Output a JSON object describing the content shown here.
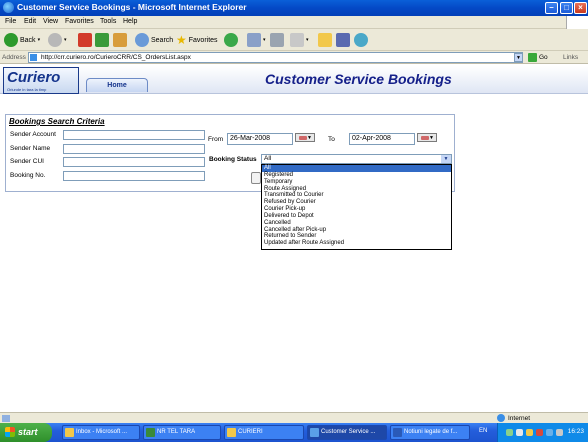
{
  "window": {
    "title": "Customer Service Bookings - Microsoft Internet Explorer"
  },
  "menu": [
    "File",
    "Edit",
    "View",
    "Favorites",
    "Tools",
    "Help"
  ],
  "toolbar": {
    "back": "Back",
    "search": "Search",
    "favorites": "Favorites"
  },
  "address": {
    "label": "Address",
    "url": "http://crr.curiero.ro/CurieroCRR/CS_OrdersList.aspx",
    "go": "Go",
    "links": "Links"
  },
  "site": {
    "logo": "Curiero",
    "tagline": "Oriunde in tara la timp",
    "home_tab": "Home",
    "page_title": "Customer Service Bookings"
  },
  "search": {
    "title": "Bookings Search Criteria",
    "sender_account_label": "Sender Account",
    "sender_name_label": "Sender Name",
    "sender_cui_label": "Sender CUI",
    "booking_no_label": "Booking No.",
    "from_label": "From",
    "from_value": "26-Mar-2008",
    "to_label": "To",
    "to_value": "02-Apr-2008",
    "booking_status_label": "Booking Status",
    "booking_status_value": "All",
    "status_options": [
      "All",
      "Registered",
      "Temporary",
      "Route Assigned",
      "Transmitted to Courier",
      "Refused by Courier",
      "Courier Pick-up",
      "Delivered to Depot",
      "Cancelled",
      "Cancelled after Pick-up",
      "Returned to Sender",
      "Updated after Route Assigned"
    ]
  },
  "status": {
    "zone": "Internet"
  },
  "taskbar": {
    "start": "start",
    "tasks": [
      "Inbox - Microsoft ...",
      "NR TEL TARA",
      "CURIERI",
      "Customer Service ...",
      "Notiuni legate de f..."
    ],
    "lang": "EN",
    "clock": "16:23"
  }
}
